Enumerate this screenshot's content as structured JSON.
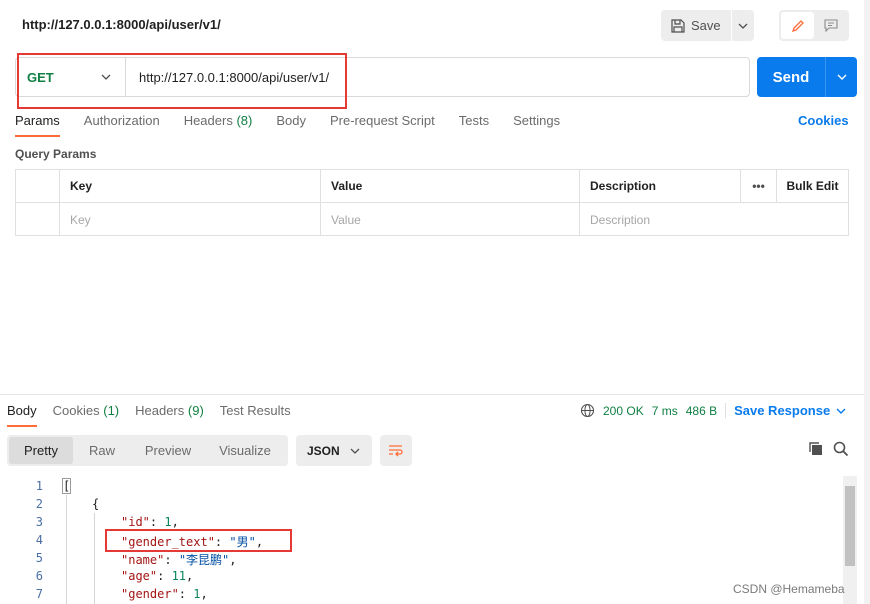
{
  "header": {
    "url_title": "http://127.0.0.1:8000/api/user/v1/",
    "save_label": "Save"
  },
  "request": {
    "method": "GET",
    "url": "http://127.0.0.1:8000/api/user/v1/",
    "send_label": "Send"
  },
  "request_tabs": [
    {
      "label": "Params",
      "count": ""
    },
    {
      "label": "Authorization",
      "count": ""
    },
    {
      "label": "Headers",
      "count": "(8)"
    },
    {
      "label": "Body",
      "count": ""
    },
    {
      "label": "Pre-request Script",
      "count": ""
    },
    {
      "label": "Tests",
      "count": ""
    },
    {
      "label": "Settings",
      "count": ""
    }
  ],
  "cookies_label": "Cookies",
  "query_params": {
    "title": "Query Params",
    "headers": {
      "key": "Key",
      "value": "Value",
      "description": "Description",
      "more": "•••",
      "bulk_edit": "Bulk Edit"
    },
    "placeholders": {
      "key": "Key",
      "value": "Value",
      "description": "Description"
    }
  },
  "response_tabs": [
    {
      "label": "Body",
      "count": ""
    },
    {
      "label": "Cookies",
      "count": "(1)"
    },
    {
      "label": "Headers",
      "count": "(9)"
    },
    {
      "label": "Test Results",
      "count": ""
    }
  ],
  "status": {
    "code": "200 OK",
    "time": "7 ms",
    "size": "486 B",
    "save_response": "Save Response"
  },
  "view_tabs": [
    "Pretty",
    "Raw",
    "Preview",
    "Visualize"
  ],
  "format": "JSON",
  "code_lines": [
    {
      "n": "1"
    },
    {
      "n": "2"
    },
    {
      "n": "3"
    },
    {
      "n": "4"
    },
    {
      "n": "5"
    },
    {
      "n": "6"
    },
    {
      "n": "7"
    }
  ],
  "code": {
    "l1": "[",
    "l2": "{",
    "l3_key": "\"id\"",
    "l3_val": "1",
    "l4_key": "\"gender_text\"",
    "l4_val": "\"男\"",
    "l5_key": "\"name\"",
    "l5_val": "\"李昆鹏\"",
    "l6_key": "\"age\"",
    "l6_val": "11",
    "l7_key": "\"gender\"",
    "l7_val": "1"
  },
  "watermark": "CSDN @Hemameba",
  "colors": {
    "accent": "#097bed",
    "method_get": "#0f7f42",
    "tab_active": "#ff6c37",
    "highlight": "#e53935"
  }
}
